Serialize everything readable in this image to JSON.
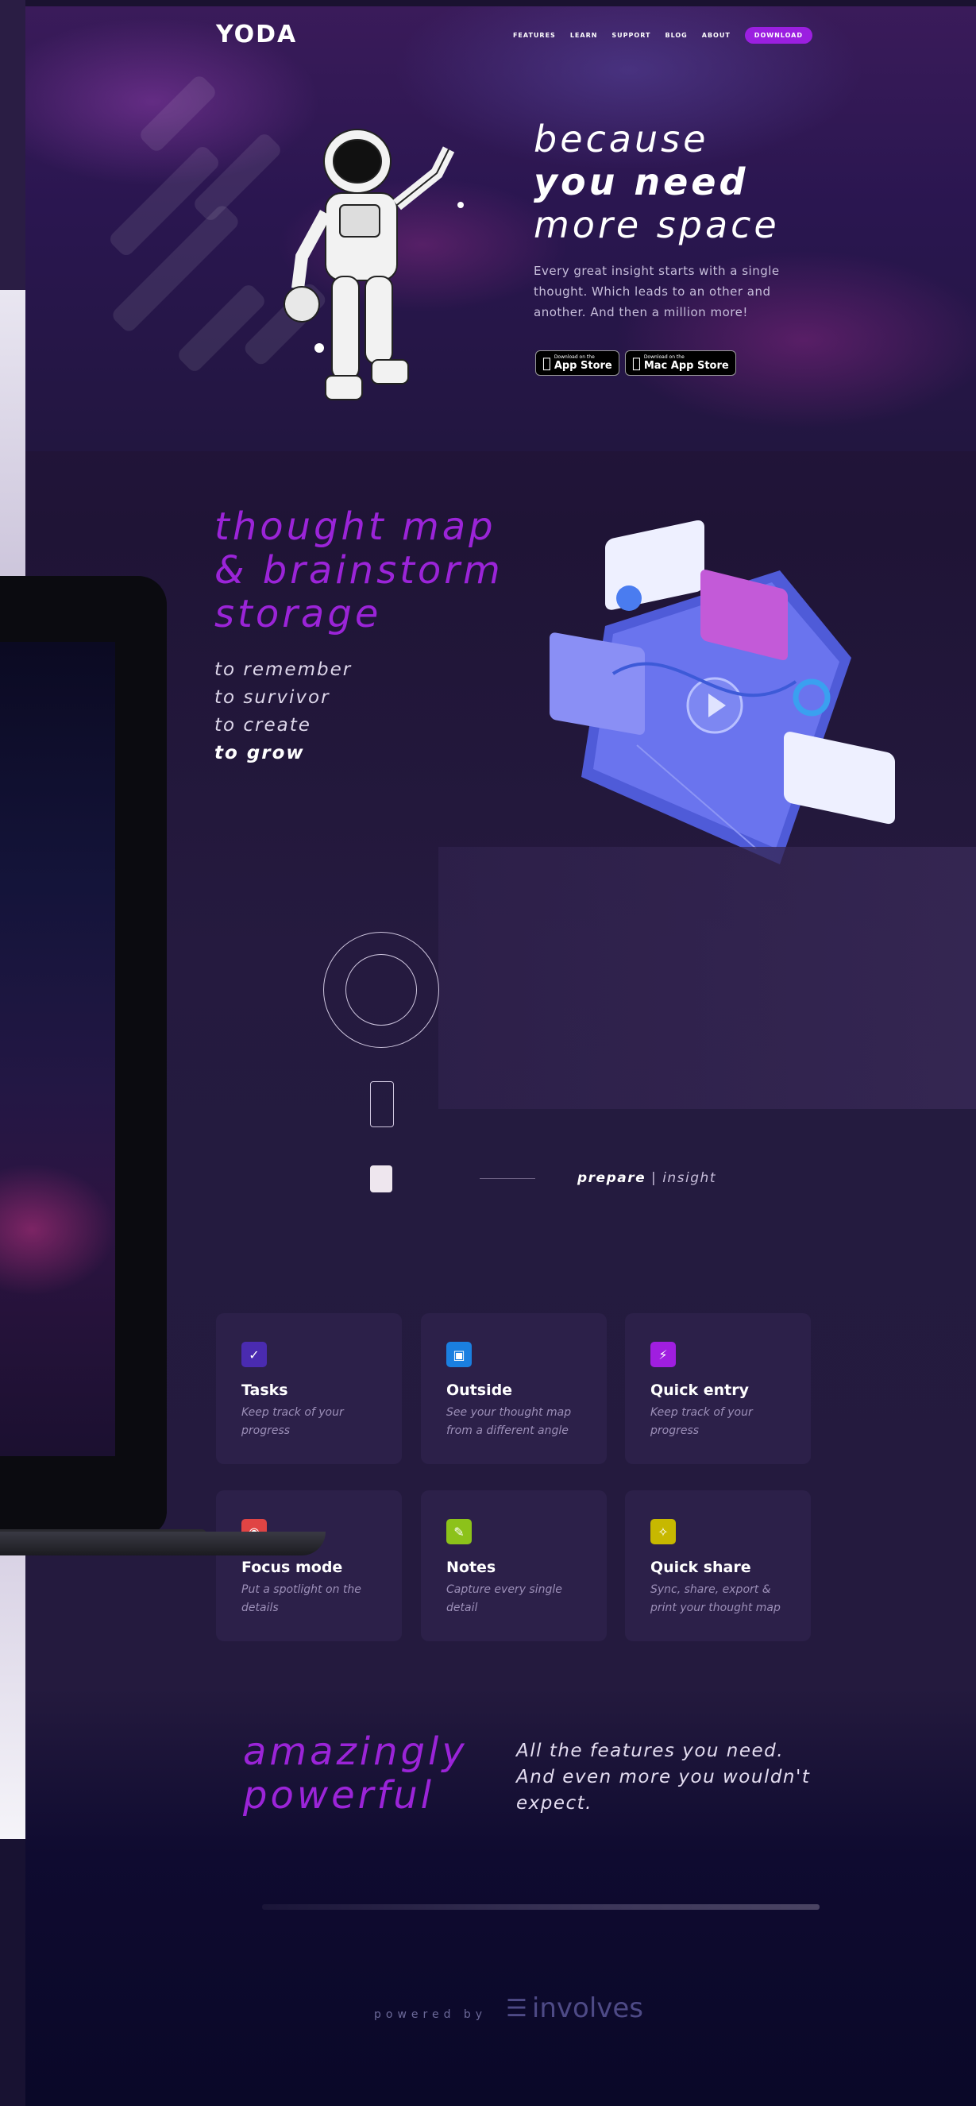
{
  "header": {
    "logo": "YODA",
    "nav": [
      "FEATURES",
      "LEARN",
      "SUPPORT",
      "BLOG",
      "ABOUT"
    ],
    "download_label": "DOWNLOAD"
  },
  "hero": {
    "title_line1": "because",
    "title_line2": "you need",
    "title_line3": "more space",
    "copy": "Every great insight starts with a single thought. Which leads to an other and another. And then a million more!",
    "stores": [
      {
        "small": "Download on the",
        "big": "App Store"
      },
      {
        "small": "Download on the",
        "big": "Mac App Store"
      }
    ]
  },
  "thought_map": {
    "title_line1": "thought map",
    "title_line2": "& brainstorm",
    "title_line3": "storage",
    "list": [
      "to remember",
      "to survivor",
      "to create",
      "to grow"
    ]
  },
  "tabs": {
    "active": "prepare",
    "separator": "|",
    "inactive": "insight"
  },
  "features": [
    {
      "title": "Tasks",
      "desc": "Keep track of your progress",
      "icon": "check-icon",
      "color": "#4a2bb0"
    },
    {
      "title": "Outside",
      "desc": "See your thought map from a different angle",
      "icon": "cube-icon",
      "color": "#1a7fe0"
    },
    {
      "title": "Quick entry",
      "desc": "Keep track of your progress",
      "icon": "bolt-icon",
      "color": "#a01ee0"
    },
    {
      "title": "Focus mode",
      "desc": "Put a spotlight on the details",
      "icon": "focus-icon",
      "color": "#e04444"
    },
    {
      "title": "Notes",
      "desc": "Capture every single detail",
      "icon": "note-icon",
      "color": "#8cc21a"
    },
    {
      "title": "Quick share",
      "desc": "Sync, share, export & print your thought map",
      "icon": "share-icon",
      "color": "#c7b800"
    }
  ],
  "amazing": {
    "title_line1": "amazingly",
    "title_line2": "powerful",
    "copy": "All the features you need. And even more you wouldn't expect."
  },
  "footer": {
    "powered_by": "powered by",
    "brand": "involves"
  }
}
